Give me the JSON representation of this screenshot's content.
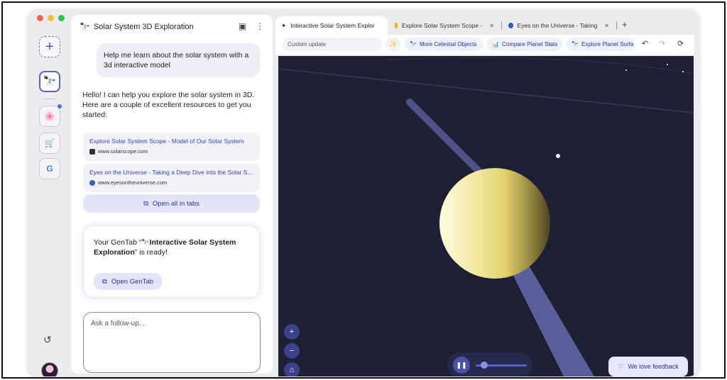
{
  "chat": {
    "title": "Solar System 3D Exploration",
    "user_message": "Help me learn about the solar system with a 3d interactive model",
    "assistant_message": "Hello! I can help you explore the solar system in 3D. Here are a couple of excellent resources to get you started:",
    "links": [
      {
        "title": "Explore Solar System Scope - Model of Our Solar System",
        "url": "www.solarscope.com"
      },
      {
        "title": "Eyes on the Universe - Taking a Deep Dive into the Solar System",
        "url": "www.eyesontheuniverse.com"
      }
    ],
    "open_all_label": "Open all in tabs",
    "gentab": {
      "prefix": "Your GenTab “",
      "name": "Interactive Solar System Exploration",
      "suffix": "” is ready!",
      "button_label": "Open GenTab"
    },
    "followup_placeholder": "Ask a follow-up..."
  },
  "tabs": [
    {
      "title": "Interactive Solar System Explor",
      "icon": "sparkle-icon",
      "active": true
    },
    {
      "title": "Explore Solar System Scope -",
      "icon": "solar-scope-icon",
      "active": false
    },
    {
      "title": "Eyes on the Universe - Taking",
      "icon": "nasa-icon",
      "active": false
    }
  ],
  "toolbar": {
    "custom_placeholder": "Custom update",
    "chips": [
      "More Celestial Objects",
      "Compare Planet Stats",
      "Explore Planet Surfa"
    ]
  },
  "viewport": {
    "play_progress": 0.12,
    "feedback_label": "We love feedback",
    "colors": {
      "space": "#1d1f33",
      "planet": "#e9dc84",
      "orbit": "#5a5f9c",
      "accent": "#3d418c"
    }
  }
}
